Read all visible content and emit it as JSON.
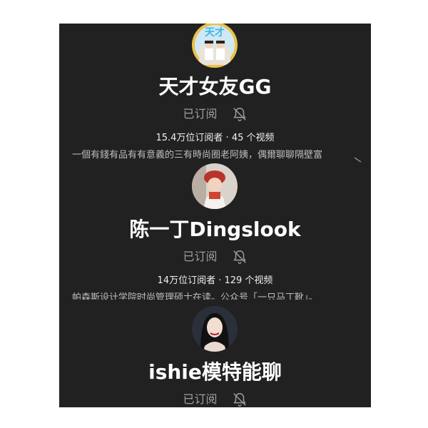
{
  "channels": [
    {
      "name": "天才女友GG",
      "subscribed_label": "已订阅",
      "stats": "15.4万位订阅者 · 45 个视频",
      "description": "一個有錢有品有有意義的三有時尚圈老阿姨，偶爾聊聊隔壁富",
      "avatar_text": "天才"
    },
    {
      "name": "陈一丁Dingslook",
      "subscribed_label": "已订阅",
      "stats": "14万位订阅者 · 129 个视频",
      "description": "帕森斯设计学院时尚管理硕士在读。公众号「一只马丁靴」。"
    },
    {
      "name": "ishie模特能聊",
      "subscribed_label": "已订阅"
    }
  ],
  "colors": {
    "panel_bg": "#212121",
    "name_text": "#ffffff",
    "muted_text": "#9e9e9e",
    "avatar1_ring": "#e8c24a"
  },
  "icons": [
    "bell-off-icon"
  ]
}
